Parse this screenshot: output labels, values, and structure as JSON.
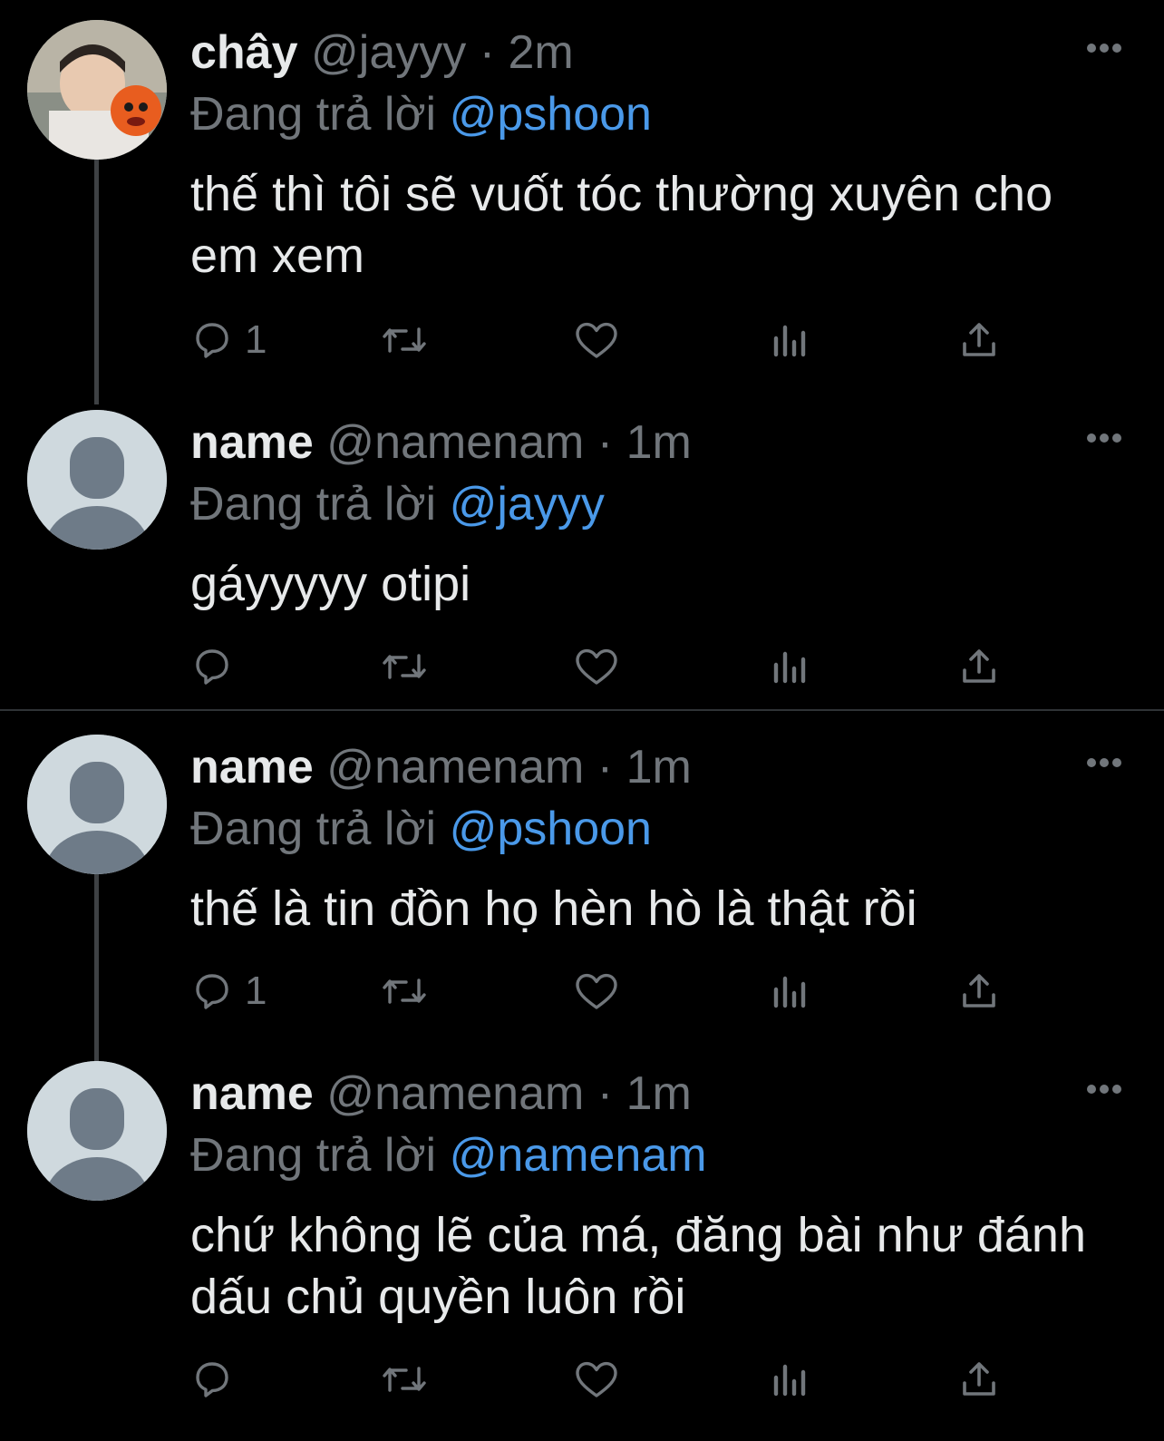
{
  "tweets": [
    {
      "name": "chây",
      "handle": "@jayyy",
      "dot": "·",
      "time": "2m",
      "replying_prefix": "Đang trả lời",
      "mention": "@pshoon",
      "text": "thế thì tôi sẽ vuốt tóc thường xuyên cho em xem",
      "reply_count": "1",
      "avatar": "photo-avatar"
    },
    {
      "name": "name",
      "handle": "@namenam",
      "dot": "·",
      "time": "1m",
      "replying_prefix": "Đang trả lời",
      "mention": "@jayyy",
      "text": "gáyyyyy otipi",
      "reply_count": "",
      "avatar": "default-avatar"
    },
    {
      "name": "name",
      "handle": "@namenam",
      "dot": "·",
      "time": "1m",
      "replying_prefix": "Đang trả lời",
      "mention": "@pshoon",
      "text": "thế là tin đồn họ hèn hò là thật rồi",
      "reply_count": "1",
      "avatar": "default-avatar"
    },
    {
      "name": "name",
      "handle": "@namenam",
      "dot": "·",
      "time": "1m",
      "replying_prefix": "Đang trả lời",
      "mention": "@namenam",
      "text": "chứ không lẽ của má, đăng bài như đánh dấu chủ quyền luôn rồi",
      "reply_count": "",
      "avatar": "default-avatar"
    }
  ],
  "icons": {
    "reply": "reply-icon",
    "retweet": "retweet-icon",
    "like": "heart-icon",
    "views": "views-icon",
    "share": "share-icon",
    "more": "more-icon"
  },
  "colors": {
    "background": "#000000",
    "text": "#e7e9ea",
    "muted": "#71767b",
    "mention": "#4a99e9",
    "divider": "#2f3336",
    "thread_line": "#3e4144"
  }
}
